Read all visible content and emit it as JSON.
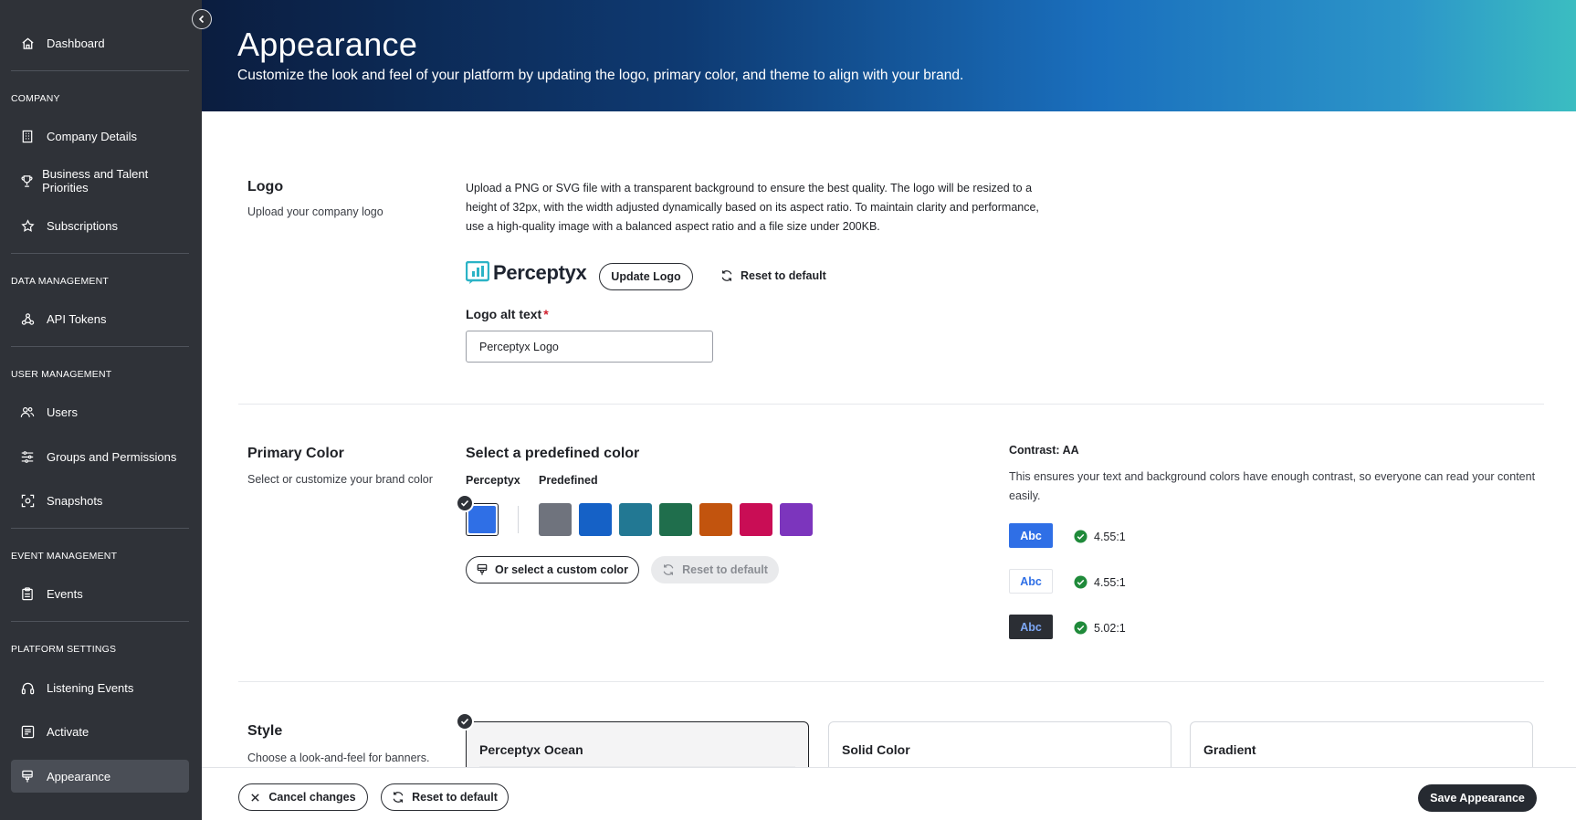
{
  "sidebar": {
    "items": {
      "dashboard": "Dashboard",
      "company_details": "Company Details",
      "business_talent": "Business and Talent Priorities",
      "subscriptions": "Subscriptions",
      "api_tokens": "API Tokens",
      "users": "Users",
      "groups": "Groups and Permissions",
      "snapshots": "Snapshots",
      "events": "Events",
      "listening_events": "Listening Events",
      "activate": "Activate",
      "appearance": "Appearance"
    },
    "sections": {
      "company": "COMPANY",
      "data_management": "DATA MANAGEMENT",
      "user_management": "USER MANAGEMENT",
      "event_management": "EVENT MANAGEMENT",
      "platform_settings": "PLATFORM SETTINGS"
    },
    "active_item": "appearance"
  },
  "header": {
    "title": "Appearance",
    "subtitle": "Customize the look and feel of your platform by updating the logo, primary color, and theme to align with your brand."
  },
  "logo": {
    "title": "Logo",
    "description": "Upload your company logo",
    "help_text": "Upload a PNG or SVG file with a transparent background to ensure the best quality. The logo will be resized to a height of 32px, with the width adjusted dynamically based on its aspect ratio. To maintain clarity and performance, use a high-quality image with a balanced aspect ratio and a file size under 200KB.",
    "brand_name": "Perceptyx",
    "update_label": "Update Logo",
    "reset_label": "Reset to default",
    "alt_label": "Logo alt text",
    "required_mark": "*",
    "alt_value": "Perceptyx Logo"
  },
  "primary_color": {
    "title": "Primary Color",
    "description": "Select or customize your brand color",
    "subhead": "Select a predefined color",
    "perceptyx_label": "Perceptyx",
    "predefined_label": "Predefined",
    "selected_color": "#2f6fe6",
    "predefined_colors": [
      "#6f737d",
      "#1561c6",
      "#227893",
      "#1f6e4c",
      "#c2540e",
      "#c90d55",
      "#7c35bd"
    ],
    "custom_label": "Or select a custom color",
    "reset_label": "Reset to default",
    "contrast": {
      "title": "Contrast: AA",
      "description": "This ensures your text and background colors have enough contrast, so everyone can read your content easily.",
      "samples": [
        {
          "text": "Abc",
          "ratio": "4.55:1"
        },
        {
          "text": "Abc",
          "ratio": "4.55:1"
        },
        {
          "text": "Abc",
          "ratio": "5.02:1"
        }
      ]
    }
  },
  "style": {
    "title": "Style",
    "description": "Choose a look-and-feel for banners.",
    "options": [
      "Perceptyx Ocean",
      "Solid Color",
      "Gradient"
    ],
    "selected": "Perceptyx Ocean"
  },
  "footer": {
    "cancel_label": "Cancel changes",
    "reset_label": "Reset to default",
    "save_label": "Save Appearance"
  },
  "colors": {
    "sidebar_bg": "#2f3238",
    "accent": "#2f6fe6",
    "success": "#1f8a3a",
    "dark_button": "#262a31"
  }
}
